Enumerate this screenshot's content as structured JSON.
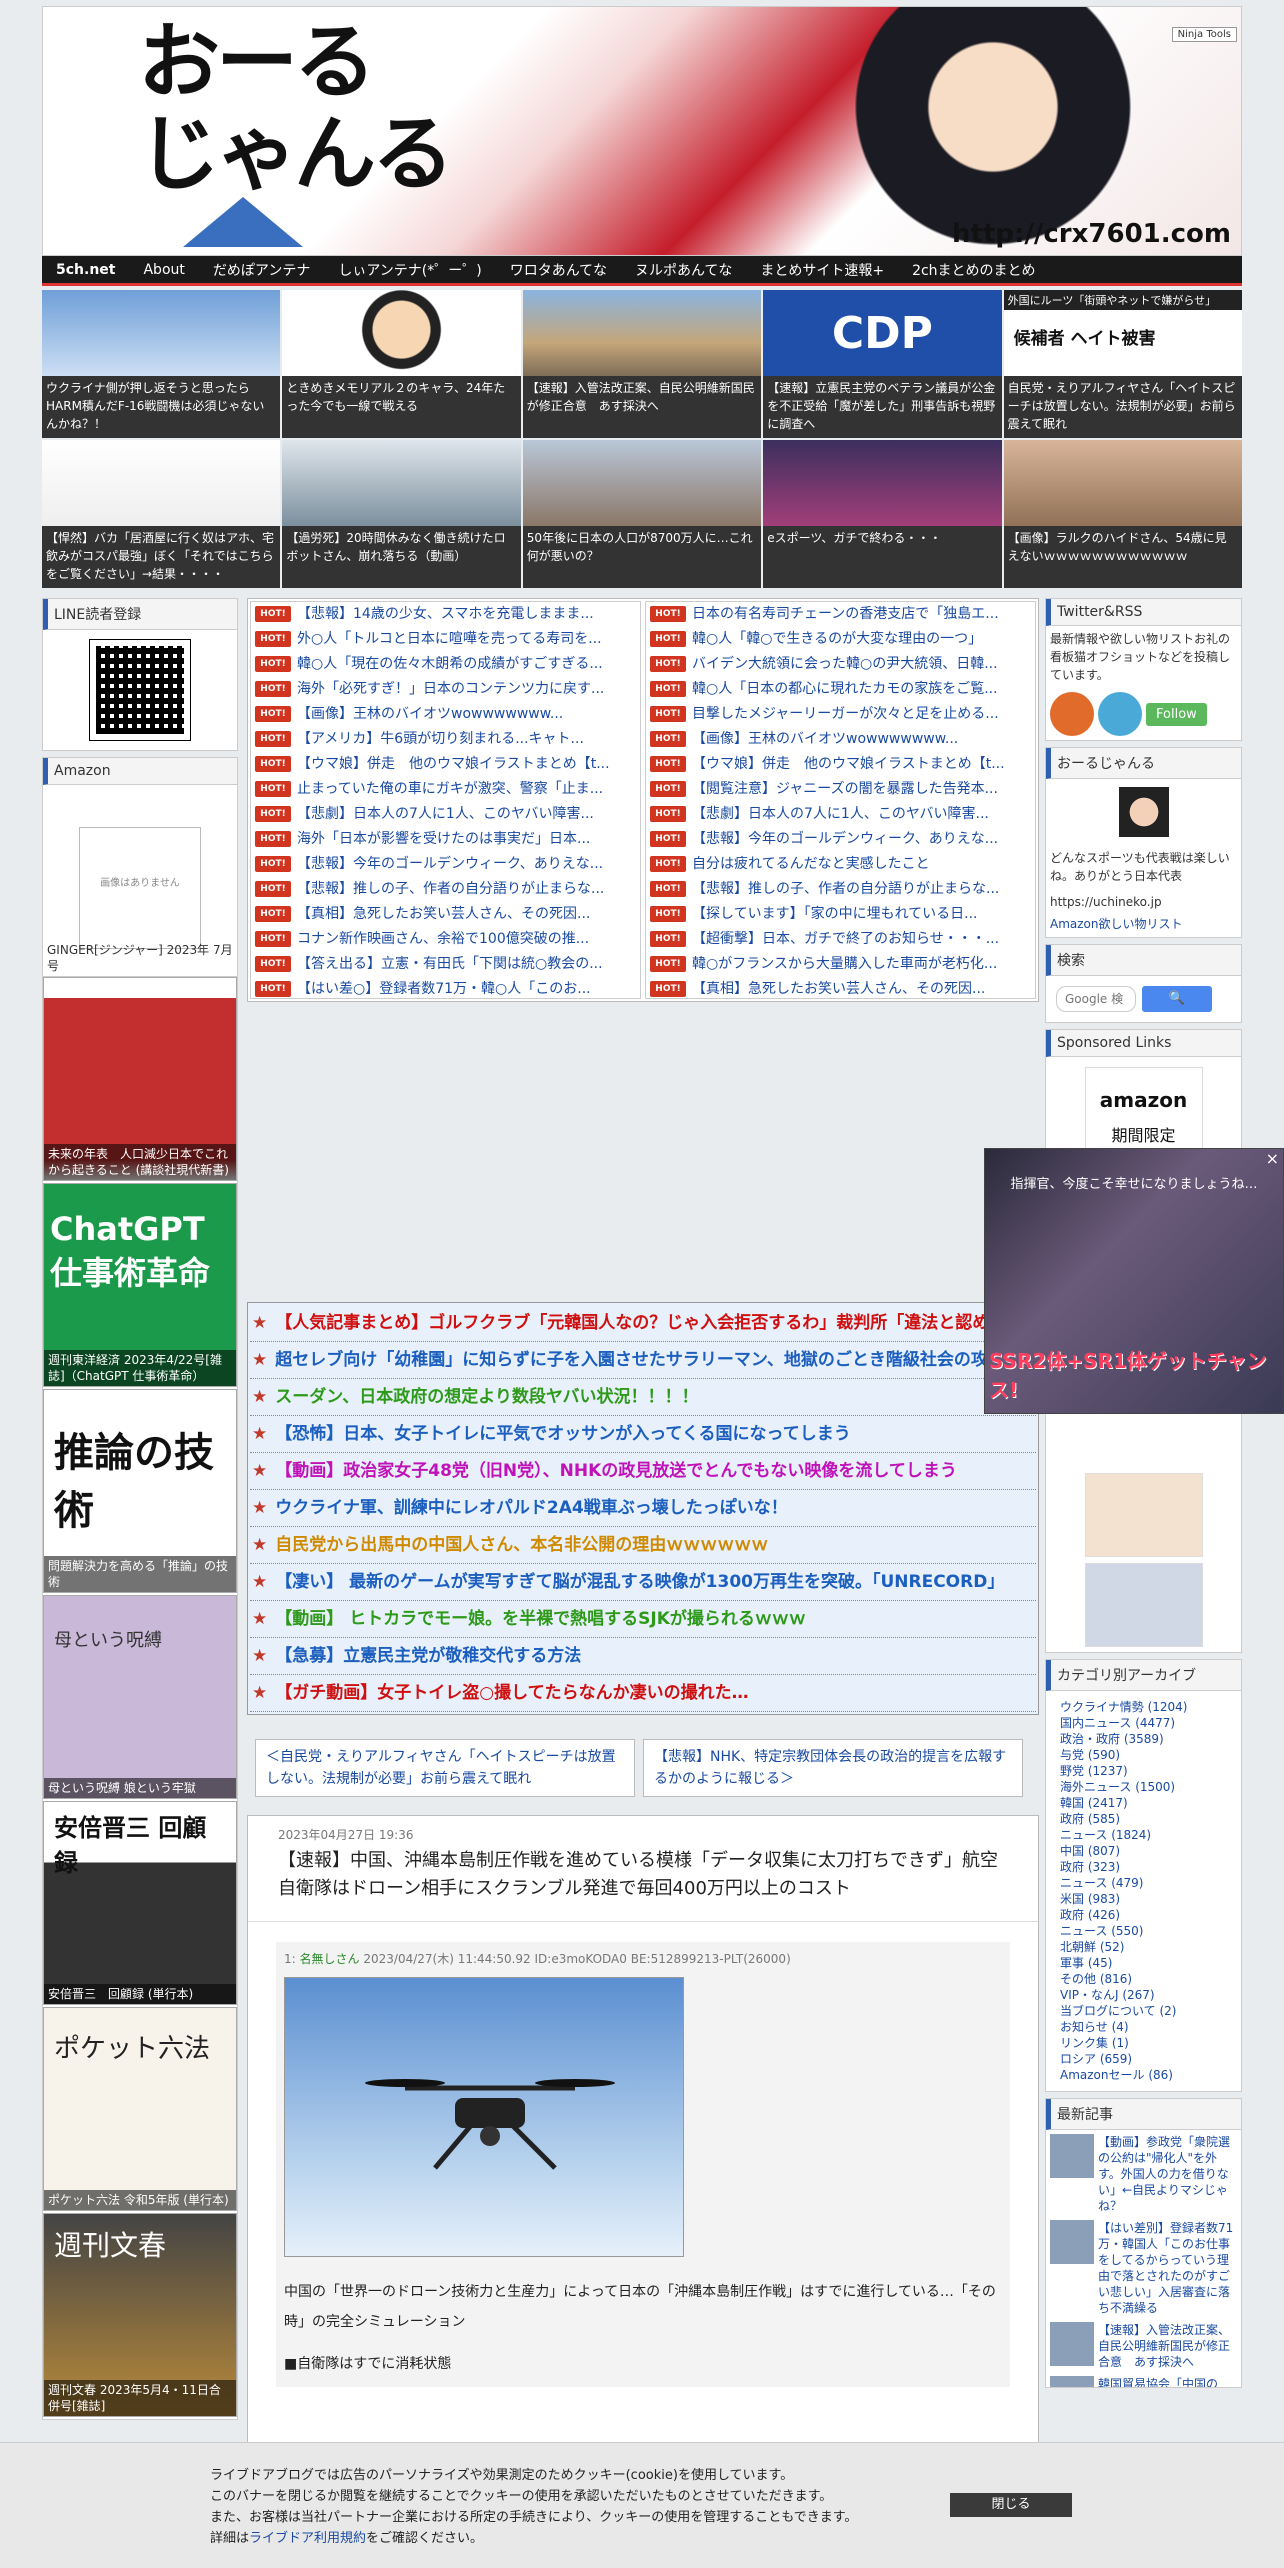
{
  "header": {
    "logo_line1": "おーる",
    "logo_line2": "じゃんる",
    "url": "http://crx7601.com",
    "ninja_tools": "Ninja Tools"
  },
  "nav": [
    "5ch.net",
    "About",
    "だめぽアンテナ",
    "しぃアンテナ(*゜ー゜)",
    "ワロタあんてな",
    "ヌルポあんてな",
    "まとめサイト速報+",
    "2chまとめのまとめ"
  ],
  "thumbs": [
    "ウクライナ側が押し返そうと思ったらHARM積んだF-16戦闘機は必須じゃないんかね？！",
    "ときめきメモリアル２のキャラ、24年たった今でも一線で戦える",
    "【速報】入管法改正案、自民公明維新国民が修正合意　あす採決へ",
    "【速報】立憲民主党のベテラン議員が公金を不正受給「魔が差した」刑事告訴も視野に調査へ",
    "自民党・えりアルフィヤさん「ヘイトスピーチは放置しない。法規制が必要」お前ら震えて眠れ",
    "【悍然】バカ「居酒屋に行く奴はアホ、宅飲みがコスパ最強」ぼく「それではこちらをご覧ください」→結果・・・・",
    "【過労死】20時間休みなく働き続けたロボットさん、崩れ落ちる（動画）",
    "50年後に日本の人口が8700万人に…これ何が悪いの？",
    "eスポーツ、ガチで終わる・・・",
    "【画像】ラルクのハイドさん、54歳に見えないｗｗｗｗｗｗｗｗｗｗｗｗ"
  ],
  "thumb5_header": "外国にルーツ「街頭やネットで嫌がらせ」",
  "thumb5_sub": "候補者 ヘイト被害",
  "left": {
    "line_title": "LINE読者登録",
    "amazon_title": "Amazon",
    "no_image": "画像はありません",
    "books": [
      "GINGER[ジンジャー] 2023年 7月号",
      "未来の年表　人口減少日本でこれから起きること (講談社現代新書)",
      "週刊東洋経済 2023年4/22号[雑誌]（ChatGPT 仕事術革命）",
      "問題解決力を高める「推論」の技術",
      "母という呪縛 娘という牢獄",
      "安倍晋三　回顧録 (単行本)",
      "ポケット六法 令和5年版 (単行本)",
      "週刊文春 2023年5月4・11日合併号[雑誌]"
    ],
    "book_cover_text": [
      "",
      "",
      "ChatGPT 仕事術革命",
      "推論の技術",
      "母という呪縛",
      "安倍晋三 回顧録",
      "ポケット六法",
      "週刊文春"
    ]
  },
  "rss_left": [
    "【悲報】14歳の少女、スマホを充電しままま...",
    "外○人「トルコと日本に喧嘩を売ってる寿司を...",
    "韓○人「現在の佐々木朗希の成績がすごすぎる...",
    "海外「必死すぎ！」日本のコンテンツ力に戻す...",
    "【画像】王林のバイオツwowwwwwww...",
    "【アメリカ】牛6頭が切り刻まれる...キャト...",
    "【ウマ娘】併走　他のウマ娘イラストまとめ【t...",
    "止まっていた俺の車にガキが激突、警察「止ま...",
    "【悲劇】日本人の7人に1人、このヤバい障害...",
    "海外「日本が影響を受けたのは事実だ」日本...",
    "【悲報】今年のゴールデンウィーク、ありえな...",
    "【悲報】推しの子、作者の自分語りが止まらな...",
    "【真相】急死したお笑い芸人さん、その死因...",
    "コナン新作映画さん、余裕で100億突破の推...",
    "【答え出る】立憲・有田氏「下関は統○教会の...",
    "【はい差○】登録者数71万・韓○人「このお..."
  ],
  "rss_right": [
    "日本の有名寿司チェーンの香港支店で「独島エ...",
    "韓○人「韓○で生きるのが大変な理由の一つ」",
    "バイデン大統領に会った韓○の尹大統領、日韓...",
    "韓○人「日本の都心に現れたカモの家族をご覧...",
    "目撃したメジャーリーガーが次々と足を止める...",
    "【画像】王林のバイオツwowwwwwww...",
    "【ウマ娘】併走　他のウマ娘イラストまとめ【t...",
    "【閲覧注意】ジャニーズの闇を暴露した告発本...",
    "【悲劇】日本人の7人に1人、このヤバい障害...",
    "【悲報】今年のゴールデンウィーク、ありえな...",
    "自分は疲れてるんだなと実感したこと",
    "【悲報】推しの子、作者の自分語りが止まらな...",
    "【探しています】「家の中に埋もれている日...",
    "【超衝撃】日本、ガチで終了のお知らせ・・・...",
    "韓○がフランスから大量購入した車両が老朽化...",
    "【真相】急死したお笑い芸人さん、その死因..."
  ],
  "hot_label": "HOT!",
  "picks": [
    {
      "text": "【人気記事まとめ】ゴルフクラブ「元韓国人なの？じゃ入会拒否するわ」裁判所「違法と認められない、その拒否合法！！」",
      "color": "#d01010"
    },
    {
      "text": "超セレブ向け「幼稚園」に知らずに子を入園させたサラリーマン、地獄のごとき階級社会の攻撃を隠せず",
      "color": "#1c5fbf"
    },
    {
      "text": "スーダン、日本政府の想定より数段ヤバい状況！！！！",
      "color": "#2e9a1a"
    },
    {
      "text": "【恐怖】日本、女子トイレに平気でオッサンが入ってくる国になってしまう",
      "color": "#1c5fbf"
    },
    {
      "text": "【動画】政治家女子48党（旧N党）、NHKの政見放送でとんでもない映像を流してしまう",
      "color": "#c012b8"
    },
    {
      "text": "ウクライナ軍、訓練中にレオパルド2A4戦車ぶっ壊したっぽいな！",
      "color": "#1c5fbf"
    },
    {
      "text": "自民党から出馬中の中国人さん、本名非公開の理由ｗｗｗｗｗｗ",
      "color": "#d08a00"
    },
    {
      "text": "【凄い】 最新のゲームが実写すぎて脳が混乱する映像が1300万再生を突破。「UNRECORD」",
      "color": "#1c5fbf"
    },
    {
      "text": "【動画】 ヒトカラでモー娘。を半裸で熱唱するSJKが撮られるｗｗｗ",
      "color": "#2e9a1a"
    },
    {
      "text": "【急募】立憲民主党が敬稚交代する方法",
      "color": "#1c5fbf"
    },
    {
      "text": "【ガチ動画】女子トイレ盗○撮してたらなんか凄いの撮れた…",
      "color": "#d01010"
    }
  ],
  "prev_link": "＜自民党・えりアルフィヤさん「ヘイトスピーチは放置しない。法規制が必要」お前ら震えて眠れ",
  "next_link": "【悲報】NHK、特定宗教団体会長の政治的提言を広報するかのように報じる＞",
  "article": {
    "date": "2023年04月27日 19:36",
    "title": "【速報】中国、沖縄本島制圧作戦を進めている模様「データ収集に太刀打ちできず」航空自衛隊はドローン相手にスクランブル発進で毎回400万円以上のコスト",
    "post_num": "1:",
    "post_name": "名無しさん",
    "post_meta": "2023/04/27(木) 11:44:50.92 ID:e3moKODA0 BE:512899213-PLT(26000)",
    "body": "中国の「世界一のドローン技術力と生産力」によって日本の「沖縄本島制圧作戦」はすでに進行している…「その時」の完全シミュレーション",
    "body2": "■自衛隊はすでに消耗状態"
  },
  "right": {
    "rss_title": "Twitter&RSS",
    "rss_desc": "最新情報や欲しい物リストお礼の看板猫オフショットなどを投稿しています。",
    "follow": "Follow",
    "profile_title": "おーるじゃんる",
    "profile_desc": "どんなスポーツも代表戦は楽しいね。ありがとう日本代表",
    "profile_url": "https://uchineko.jp",
    "amazon_wish": "Amazon欲しい物リスト",
    "search_title": "検索",
    "search_placeholder": "Google 検",
    "sponsored_title": "Sponsored Links",
    "amazon_label": "amazon",
    "amazon_sub": "期間限定",
    "cat_title": "カテゴリ別アーカイブ",
    "categories": [
      "ウクライナ情勢 (1204)",
      "国内ニュース (4477)",
      "政治・政府 (3589)",
      "与党 (590)",
      "野党 (1237)",
      "海外ニュース (1500)",
      "韓国 (2417)",
      "政府 (585)",
      "ニュース (1824)",
      "中国 (807)",
      "政府 (323)",
      "ニュース (479)",
      "米国 (983)",
      "政府 (426)",
      "ニュース (550)",
      "北朝鮮 (52)",
      "軍事 (45)",
      "その他 (816)",
      "VIP・なんJ (267)",
      "当ブログについて (2)",
      "お知らせ (4)",
      "リンク集 (1)",
      "ロシア (659)",
      "Amazonセール (86)"
    ],
    "recent_title": "最新記事",
    "recent": [
      "【動画】参政党「衆院選の公約は\"帰化人\"を外す。外国人の力を借りない」←自民よりマシじゃね？",
      "【はい差別】登録者数71万・韓国人「このお仕事をしてるからっていう理由で落とされたのがすごい悲しい」入居審査に落ち不満繰る",
      "【速報】入管法改正案、自民公明維新国民が修正合意　あす採決へ",
      "韓国貿易協会「中国のTPP加盟申請に日本が反対する可能性"
    ]
  },
  "ad": {
    "text": "指揮官、今度こそ幸せになりましょうね…",
    "cta": "SSR2体+SR1体ゲットチャンス!"
  },
  "cookie": {
    "line1": "ライブドアブログでは広告のパーソナライズや効果測定のためクッキー(cookie)を使用しています。",
    "line2": "このバナーを閉じるか閲覧を継続することでクッキーの使用を承認いただいたものとさせていただきます。",
    "line3": "また、お客様は当社パートナー企業における所定の手続きにより、クッキーの使用を管理することもできます。",
    "line4_pre": "詳細は",
    "line4_link": "ライブドア利用規約",
    "line4_post": "をご確認ください。",
    "close": "閉じる"
  }
}
